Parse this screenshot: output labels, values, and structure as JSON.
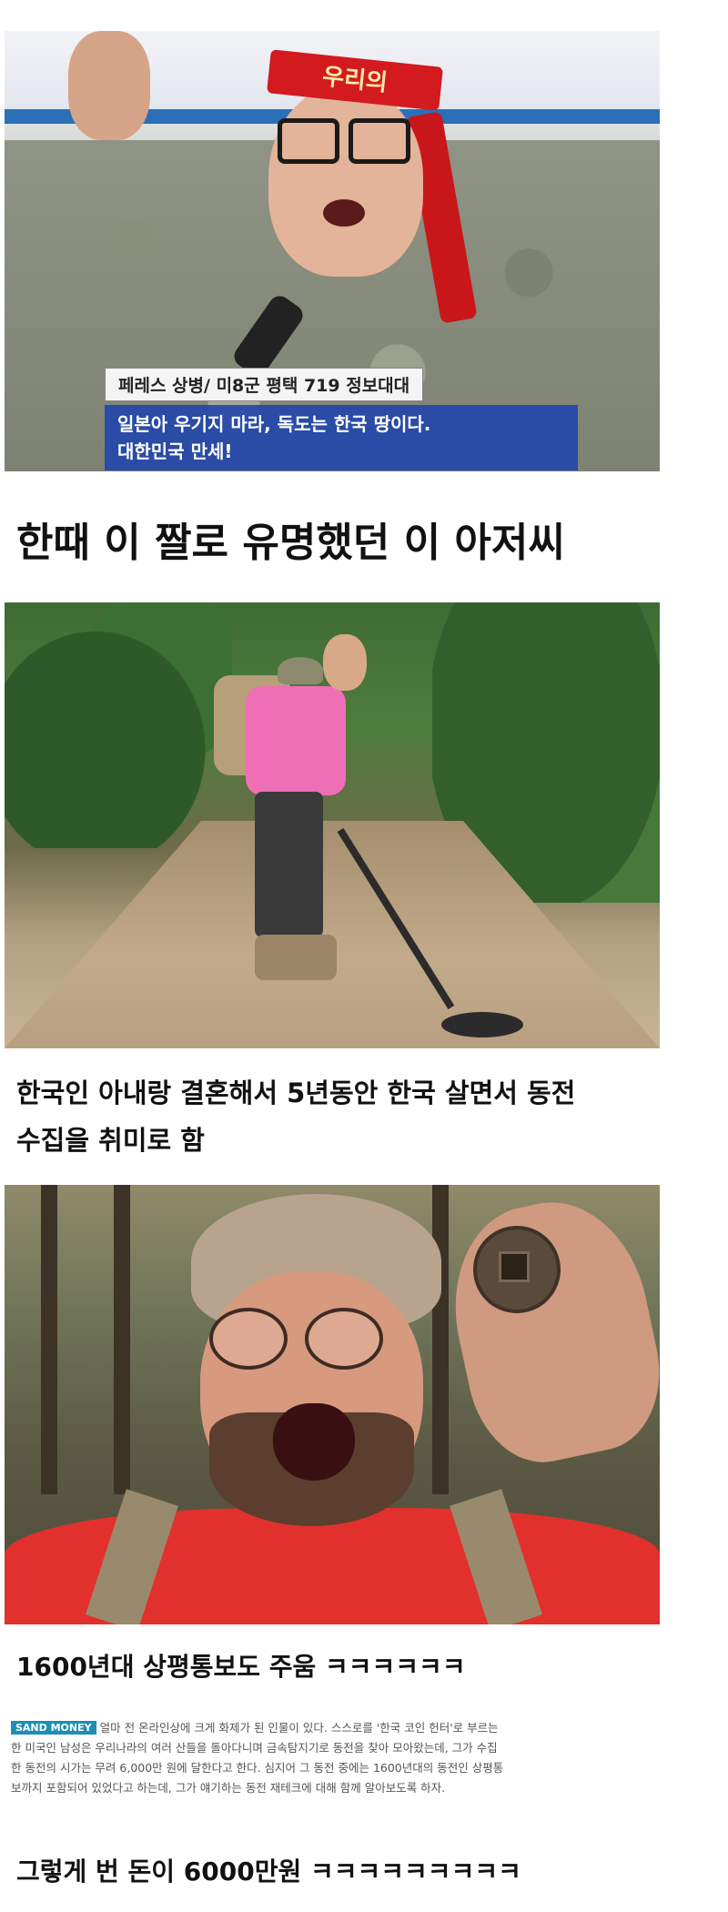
{
  "photo1": {
    "headband_text": "우리의",
    "lower_third": {
      "name_line": "페레스 상병/ 미8군 평택 719 정보대대",
      "quote_line1": "일본아 우기지 마라, 독도는 한국 땅이다.",
      "quote_line2": "대한민국 만세!"
    }
  },
  "captions": {
    "caption1": "한때 이 짤로 유명했던 이 아저씨",
    "caption2_line1": "한국인 아내랑 결혼해서 5년동안 한국 살면서 동전",
    "caption2_line2": "수집을 취미로 함",
    "caption3": "1600년대 상평통보도 주움 ㅋㅋㅋㅋㅋㅋ",
    "caption4": "그렇게 번 돈이 6000만원 ㅋㅋㅋㅋㅋㅋㅋㅋㅋ"
  },
  "snippet": {
    "tag": "SAND MONEY",
    "line1": "얼마 전 온라인상에 크게 화제가 된 인물이 있다. 스스로를 '한국 코인 헌터'로 부르는",
    "line2": "한 미국인 남성은 우리나라의 여러 산들을 돌아다니며 금속탐지기로 동전을 찾아 모아왔는데, 그가 수집",
    "line3": "한 동전의 시가는 무려 6,000만 원에 달한다고 한다. 심지어 그 동전 중에는 1600년대의 동전인 상평통",
    "line4": "보까지 포함되어 있었다고 하는데, 그가 얘기하는 동전 재테크에 대해 함께 알아보도록 하자."
  },
  "colors": {
    "banner_blue": "#2a6fb8",
    "lower_third_blue": "#2346aa",
    "headband_red": "#d21a1f",
    "tag_blue": "#1d8fb5"
  }
}
